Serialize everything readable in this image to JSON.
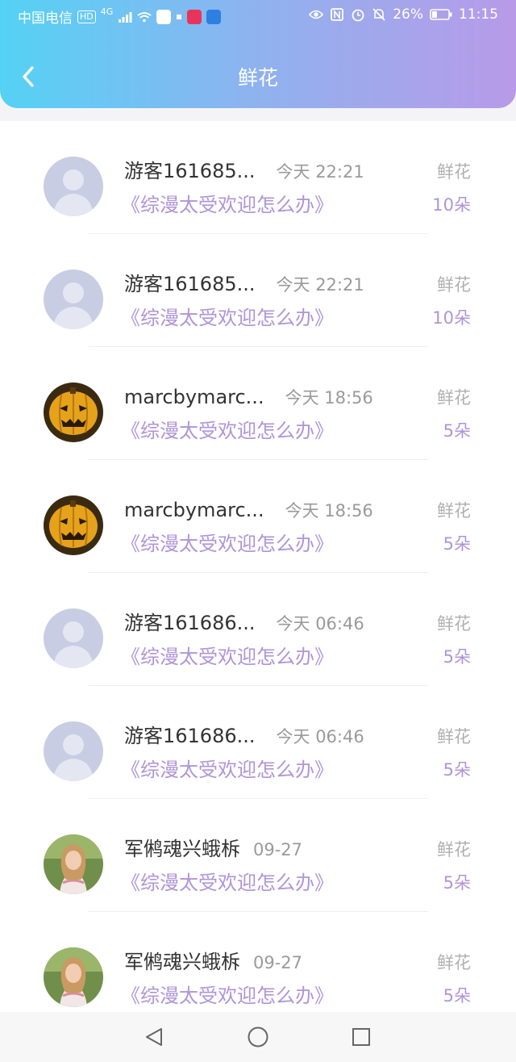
{
  "status_bar": {
    "carrier": "中国电信",
    "hd": "HD",
    "network": "4G",
    "battery": "26%",
    "time": "11:15"
  },
  "header": {
    "title": "鲜花"
  },
  "colors": {
    "header_gradient_start": "#54d2f5",
    "header_gradient_end": "#b89ae8",
    "accent": "#b094d8"
  },
  "records": [
    {
      "name": "游客161685...",
      "time": "今天 22:21",
      "book": "《综漫太受欢迎怎么办》",
      "gift_label": "鲜花",
      "gift_count": "10朵",
      "avatar": "default-avatar"
    },
    {
      "name": "游客161685...",
      "time": "今天 22:21",
      "book": "《综漫太受欢迎怎么办》",
      "gift_label": "鲜花",
      "gift_count": "10朵",
      "avatar": "default-avatar"
    },
    {
      "name": "marcbymarc...",
      "time": "今天 18:56",
      "book": "《综漫太受欢迎怎么办》",
      "gift_label": "鲜花",
      "gift_count": "5朵",
      "avatar": "pumpkin-avatar"
    },
    {
      "name": "marcbymarc...",
      "time": "今天 18:56",
      "book": "《综漫太受欢迎怎么办》",
      "gift_label": "鲜花",
      "gift_count": "5朵",
      "avatar": "pumpkin-avatar"
    },
    {
      "name": "游客161686...",
      "time": "今天 06:46",
      "book": "《综漫太受欢迎怎么办》",
      "gift_label": "鲜花",
      "gift_count": "5朵",
      "avatar": "default-avatar"
    },
    {
      "name": "游客161686...",
      "time": "今天 06:46",
      "book": "《综漫太受欢迎怎么办》",
      "gift_label": "鲜花",
      "gift_count": "5朵",
      "avatar": "default-avatar"
    },
    {
      "name": "军鸺魂兴蛾柝",
      "time": "09-27",
      "book": "《综漫太受欢迎怎么办》",
      "gift_label": "鲜花",
      "gift_count": "5朵",
      "avatar": "photo-avatar"
    },
    {
      "name": "军鸺魂兴蛾柝",
      "time": "09-27",
      "book": "《综漫太受欢迎怎么办》",
      "gift_label": "鲜花",
      "gift_count": "5朵",
      "avatar": "photo-avatar"
    }
  ],
  "nav_buttons": [
    "back-triangle-icon",
    "home-circle-icon",
    "recents-square-icon"
  ]
}
